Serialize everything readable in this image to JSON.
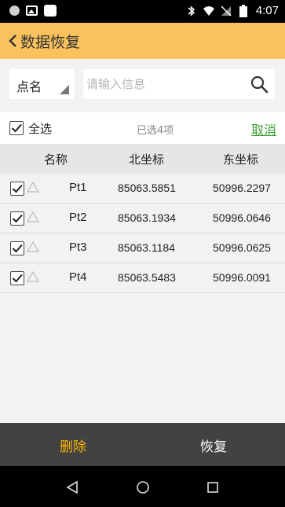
{
  "status_bar": {
    "time": "4:07",
    "icons": [
      "record-icon",
      "image-icon",
      "app-icon",
      "bluetooth-icon",
      "wifi-icon",
      "no-sim-icon",
      "battery-icon"
    ]
  },
  "header": {
    "title": "数据恢复",
    "back_icon": "chevron-left-icon",
    "background": "#f9c25c"
  },
  "search": {
    "field_select": "点名",
    "placeholder": "请输入信息",
    "value": "",
    "search_icon": "magnifier-icon"
  },
  "selection": {
    "select_all_label": "全选",
    "select_all_checked": true,
    "selected_count": "已选4项",
    "cancel_label": "取消",
    "cancel_color": "#3aa02f"
  },
  "table": {
    "columns": [
      "名称",
      "北坐标",
      "东坐标"
    ],
    "rows": [
      {
        "checked": true,
        "name": "Pt1",
        "north": "85063.5851",
        "east": "50996.2297"
      },
      {
        "checked": true,
        "name": "Pt2",
        "north": "85063.1934",
        "east": "50996.0646"
      },
      {
        "checked": true,
        "name": "Pt3",
        "north": "85063.1184",
        "east": "50996.0625"
      },
      {
        "checked": true,
        "name": "Pt4",
        "north": "85063.5483",
        "east": "50996.0091"
      }
    ]
  },
  "actions": {
    "delete_label": "删除",
    "restore_label": "恢复",
    "delete_color": "#f9b400"
  },
  "nav": {
    "icons": [
      "back-triangle-icon",
      "home-circle-icon",
      "recents-square-icon"
    ]
  }
}
